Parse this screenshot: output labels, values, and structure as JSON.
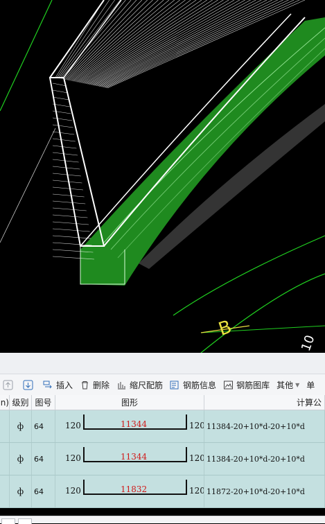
{
  "toolbar": {
    "insert": "插入",
    "delete": "删除",
    "scale_rebar": "缩尺配筋",
    "rebar_info": "钢筋信息",
    "rebar_library": "钢筋图库",
    "other": "其他",
    "single": "单"
  },
  "table": {
    "headers": [
      "n)",
      "级别",
      "图号",
      "图形",
      "计算公"
    ],
    "rows": [
      {
        "grade": "ф",
        "figure_no": "64",
        "left": "120",
        "length": "11344",
        "right": "120",
        "formula": "11384-20+10*d-20+10*d"
      },
      {
        "grade": "ф",
        "figure_no": "64",
        "left": "120",
        "length": "11344",
        "right": "120",
        "formula": "11384-20+10*d-20+10*d"
      },
      {
        "grade": "ф",
        "figure_no": "64",
        "left": "120",
        "length": "11832",
        "right": "120",
        "formula": "11872-20+10*d-20+10*d"
      }
    ]
  },
  "viewport": {
    "axis_label": "B",
    "dimension_label": "10"
  },
  "colors": {
    "rebar_green": "#1f8a1f",
    "wireframe": "#ffffff",
    "axis_yellow": "#e8e040",
    "grid_green": "#20d020",
    "row_bg": "#c4e0e0",
    "length_red": "#d01818"
  }
}
